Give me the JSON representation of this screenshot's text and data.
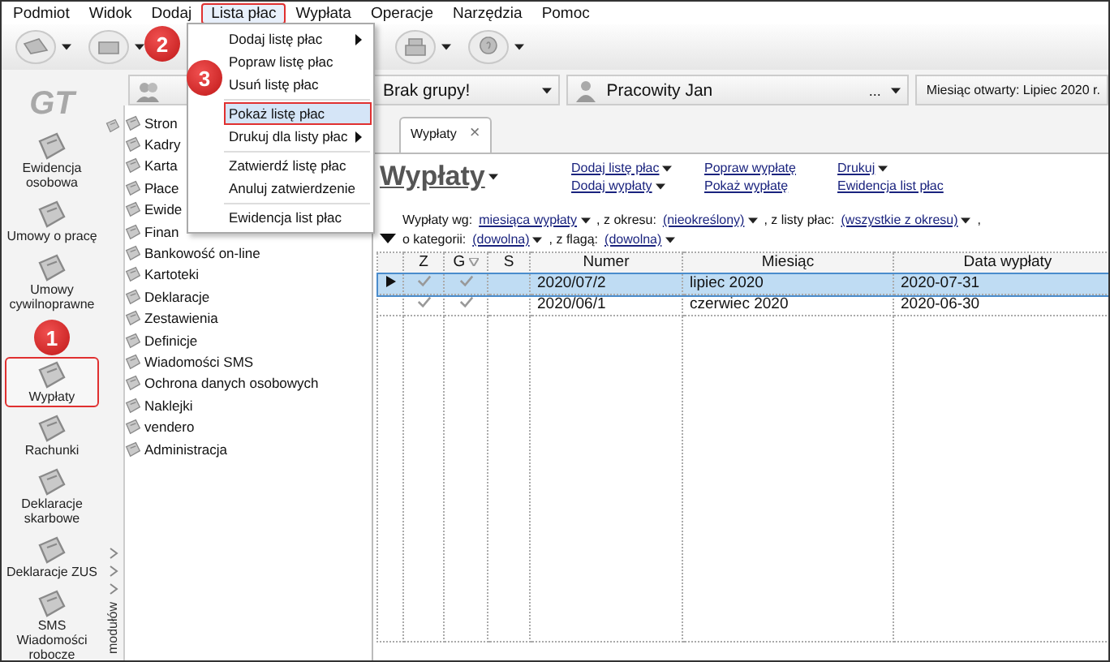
{
  "menu_bar": [
    {
      "label": "Podmiot",
      "selected": false
    },
    {
      "label": "Widok",
      "selected": false
    },
    {
      "label": "Dodaj",
      "selected": false
    },
    {
      "label": "Lista płac",
      "selected": true
    },
    {
      "label": "Wypłata",
      "selected": false
    },
    {
      "label": "Operacje",
      "selected": false
    },
    {
      "label": "Narzędzia",
      "selected": false
    },
    {
      "label": "Pomoc",
      "selected": false
    }
  ],
  "dropdown": [
    {
      "kind": "submenu",
      "label": "Dodaj listę płac",
      "selected": false
    },
    {
      "kind": "item",
      "label": "Popraw listę płac",
      "selected": false
    },
    {
      "kind": "item",
      "label": "Usuń listę płac",
      "selected": false
    },
    {
      "kind": "separator"
    },
    {
      "kind": "item",
      "label": "Pokaż listę płac",
      "selected": true
    },
    {
      "kind": "submenu",
      "label": "Drukuj dla listy płac",
      "selected": false
    },
    {
      "kind": "separator"
    },
    {
      "kind": "item",
      "label": "Zatwierdź listę płac",
      "selected": false
    },
    {
      "kind": "item",
      "label": "Anuluj zatwierdzenie",
      "selected": false
    },
    {
      "kind": "separator"
    },
    {
      "kind": "item",
      "label": "Ewidencja list płac",
      "selected": false
    }
  ],
  "callouts": [
    "1",
    "2",
    "3"
  ],
  "logo": "GT",
  "modules": [
    {
      "label": "Ewidencja osobowa",
      "selected": false
    },
    {
      "label": "Umowy o pracę",
      "selected": false
    },
    {
      "label": "Umowy cywilnoprawne",
      "selected": false
    },
    {
      "label": "Wypłaty",
      "selected": true
    },
    {
      "label": "Rachunki",
      "selected": false
    },
    {
      "label": "Deklaracje skarbowe",
      "selected": false
    },
    {
      "label": "Deklaracje ZUS",
      "selected": false
    },
    {
      "label": "SMS Wiadomości robocze",
      "selected": false
    }
  ],
  "modules_panel_label": "modułów",
  "header": {
    "group": "Brak grupy!",
    "employee": "Pracowity Jan",
    "employee_more": "...",
    "status": "Miesiąc otwarty: Lipiec 2020 r."
  },
  "tree": [
    "Stron",
    "Kadry",
    "Karta",
    "Płace",
    "Ewide",
    "Finan",
    "Bankowość on-line",
    "Kartoteki",
    "Deklaracje",
    "Zestawienia",
    "Definicje",
    "Wiadomości SMS",
    "Ochrona danych osobowych",
    "Naklejki",
    "vendero",
    "Administracja"
  ],
  "tab": {
    "label": "Wypłaty",
    "close": "×"
  },
  "page_title": "Wypłaty",
  "actions": [
    [
      {
        "label": "Dodaj listę płac",
        "has_menu": true
      },
      {
        "label": "Dodaj wypłaty",
        "has_menu": true
      }
    ],
    [
      {
        "label": "Popraw wypłatę",
        "has_menu": false
      },
      {
        "label": "Pokaż wypłatę",
        "has_menu": false
      }
    ],
    [
      {
        "label": "Drukuj",
        "has_menu": true
      },
      {
        "label": "Ewidencja list płac",
        "has_menu": false
      }
    ]
  ],
  "filters": [
    [
      {
        "kind": "label",
        "text": "Wypłaty wg:"
      },
      {
        "kind": "value",
        "text": "miesiąca wypłaty"
      },
      {
        "kind": "label",
        "text": ", z okresu:"
      },
      {
        "kind": "value",
        "text": "(nieokreślony)"
      },
      {
        "kind": "label",
        "text": ", z listy płac:"
      },
      {
        "kind": "value",
        "text": "(wszystkie z okresu)"
      },
      {
        "kind": "label",
        "text": ","
      }
    ],
    [
      {
        "kind": "label",
        "text": "o kategorii:"
      },
      {
        "kind": "value",
        "text": "(dowolna)"
      },
      {
        "kind": "label",
        "text": ", z flagą:"
      },
      {
        "kind": "value",
        "text": "(dowolna)"
      }
    ]
  ],
  "table": {
    "columns": [
      "Z",
      "G",
      "S",
      "Numer",
      "Miesiąc",
      "Data wypłaty"
    ],
    "rows": [
      {
        "selected": true,
        "z": true,
        "g": true,
        "cells": [
          "2020/07/2",
          "lipiec 2020",
          "2020-07-31"
        ]
      },
      {
        "selected": false,
        "z": true,
        "g": true,
        "cells": [
          "2020/06/1",
          "czerwiec 2020",
          "2020-06-30"
        ]
      }
    ]
  }
}
